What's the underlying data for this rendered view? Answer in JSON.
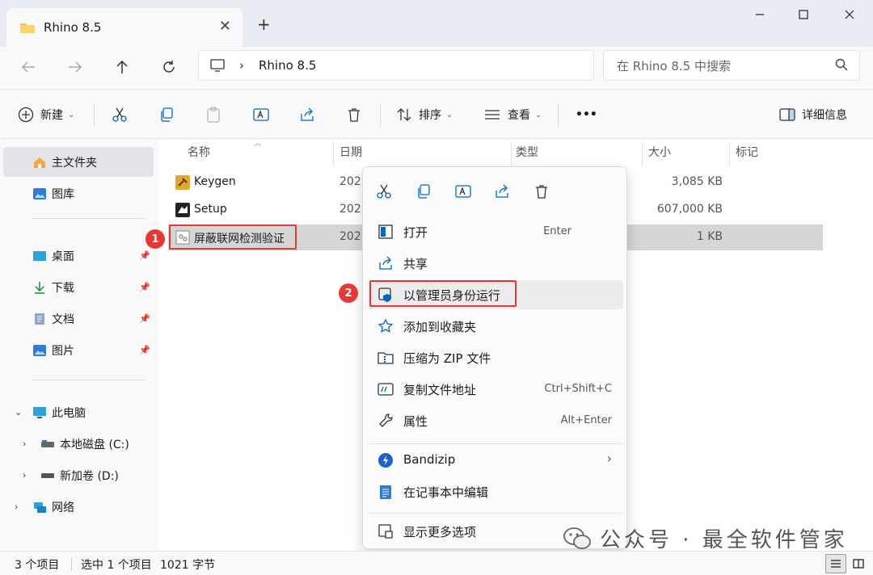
{
  "window": {
    "tab_title": "Rhino 8.5",
    "tab_close": "✕",
    "new_tab": "+"
  },
  "nav": {
    "address_path": "Rhino 8.5",
    "search_placeholder": "在 Rhino 8.5 中搜索"
  },
  "toolbar": {
    "new_label": "新建",
    "sort_label": "排序",
    "view_label": "查看",
    "more_label": "•••",
    "details_label": "详细信息"
  },
  "sidebar": {
    "home": "主文件夹",
    "gallery": "图库",
    "desktop": "桌面",
    "downloads": "下载",
    "documents": "文档",
    "pictures": "图片",
    "this_pc": "此电脑",
    "drive_c": "本地磁盘 (C:)",
    "drive_d": "新加卷 (D:)",
    "network": "网络"
  },
  "columns": {
    "name": "名称",
    "date": "日期",
    "type": "类型",
    "size": "大小",
    "tags": "标记"
  },
  "files": [
    {
      "name": "Keygen",
      "date": "202",
      "size": "3,085 KB"
    },
    {
      "name": "Setup",
      "date": "202",
      "size": "607,000 KB"
    },
    {
      "name": "屏蔽联网检测验证",
      "date": "202",
      "size": "1 KB"
    }
  ],
  "context_menu": {
    "open": "打开",
    "open_shortcut": "Enter",
    "share": "共享",
    "run_as_admin": "以管理员身份运行",
    "add_favorites": "添加到收藏夹",
    "compress_zip": "压缩为 ZIP 文件",
    "copy_path": "复制文件地址",
    "copy_path_shortcut": "Ctrl+Shift+C",
    "properties": "属性",
    "properties_shortcut": "Alt+Enter",
    "bandizip": "Bandizip",
    "edit_notepad": "在记事本中编辑",
    "more_options": "显示更多选项"
  },
  "badges": {
    "one": "1",
    "two": "2"
  },
  "status": {
    "item_count": "3 个项目",
    "selected": "选中 1 个项目",
    "size": "1021 字节"
  },
  "watermark": "公众号 · 最全软件管家",
  "colors": {
    "accent": "#0067c0",
    "highlight_red": "#e53935",
    "folder_yellow": "#f4c542"
  }
}
